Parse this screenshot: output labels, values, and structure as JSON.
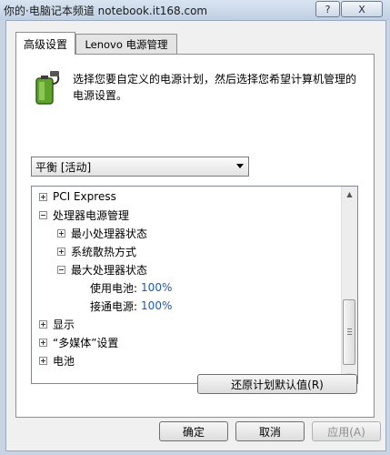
{
  "titlebar": {
    "watermark": "你的·电脑记本频道 notebook.it168.com",
    "help_label": "?",
    "close_label": "X"
  },
  "tabs": [
    {
      "label": "高级设置",
      "active": true
    },
    {
      "label": "Lenovo 电源管理",
      "active": false
    }
  ],
  "description": "选择您要自定义的电源计划，然后选择您希望计算机管理的电源设置。",
  "icons": {
    "plan_icon": "battery-plug-icon"
  },
  "plan_select": {
    "value": "平衡 [活动]"
  },
  "tree": {
    "items": [
      {
        "label": "PCI Express",
        "expanded": false,
        "level": 0
      },
      {
        "label": "处理器电源管理",
        "expanded": true,
        "level": 0
      },
      {
        "label": "最小处理器状态",
        "expanded": false,
        "level": 1
      },
      {
        "label": "系统散热方式",
        "expanded": false,
        "level": 1
      },
      {
        "label": "最大处理器状态",
        "expanded": true,
        "level": 1
      },
      {
        "label": "使用电池:",
        "value": "100%",
        "level": 2
      },
      {
        "label": "接通电源:",
        "value": "100%",
        "level": 2
      },
      {
        "label": "显示",
        "expanded": false,
        "level": 0
      },
      {
        "label": "“多媒体”设置",
        "expanded": false,
        "level": 0
      },
      {
        "label": "电池",
        "expanded": false,
        "level": 0
      }
    ]
  },
  "buttons": {
    "restore": "还原计划默认值(R)",
    "ok": "确定",
    "cancel": "取消",
    "apply": "应用(A)"
  },
  "colors": {
    "value_text": "#1c58b5",
    "icon_green": "#5fa32b"
  }
}
